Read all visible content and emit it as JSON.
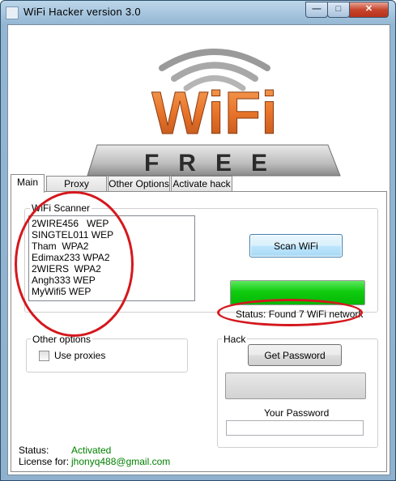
{
  "window": {
    "title": "WiFi  Hacker version 3.0"
  },
  "logo": {
    "top_text": "WiFi",
    "bottom_text": "FREE"
  },
  "tabs": [
    {
      "label": "Main"
    },
    {
      "label": "Proxy Options"
    },
    {
      "label": "Other Options"
    },
    {
      "label": "Activate hack"
    }
  ],
  "scanner": {
    "group_label": "WiFi Scanner",
    "networks": [
      "2WIRE456   WEP",
      "SINGTEL011 WEP",
      "Tham  WPA2",
      "Edimax233 WPA2",
      "2WIERS  WPA2",
      "Angh333 WEP",
      "MyWifi5 WEP"
    ],
    "scan_button": "Scan WiFi",
    "progress": 1.0,
    "status": "Status: Found 7 WiFi network"
  },
  "other_options": {
    "group_label": "Other options",
    "use_proxies_label": "Use proxies",
    "use_proxies_checked": false
  },
  "hack": {
    "group_label": "Hack",
    "get_password_button": "Get Password",
    "your_password_label": "Your Password",
    "password_value": ""
  },
  "footer": {
    "status_label": "Status:",
    "status_value": "Activated",
    "license_label": "License for:",
    "license_value": "jhonyq488@gmail.com"
  },
  "colors": {
    "accent_green": "#008000",
    "progress_green": "#0fcc0f",
    "annotation_red": "#d4181e",
    "logo_orange": "#e8742a",
    "logo_blue": "#1a6fc4"
  }
}
